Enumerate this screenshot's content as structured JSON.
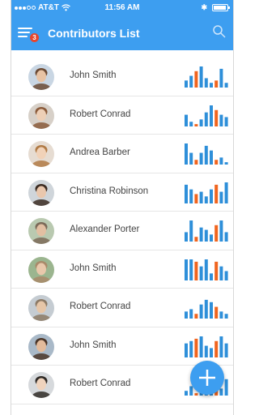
{
  "status_bar": {
    "carrier": "AT&T",
    "time": "11:56 AM",
    "bluetooth": "Ȣ"
  },
  "navbar": {
    "title": "Contributors List",
    "badge_count": "3",
    "menu_icon": "hamburger-menu-icon",
    "search_icon": "search-icon"
  },
  "colors": {
    "primary": "#3d9ef0",
    "badge": "#e8452c",
    "bar_blue": "#2e8fd9",
    "bar_orange": "#f0641e"
  },
  "contributors": [
    {
      "name": "John Smith",
      "bars": [
        3,
        5,
        7,
        9,
        4,
        2,
        3,
        8,
        2
      ]
    },
    {
      "name": "Robert Conrad",
      "bars": [
        5,
        2,
        1,
        3,
        6,
        9,
        7,
        5,
        4
      ]
    },
    {
      "name": "Andrea Barber",
      "bars": [
        9,
        5,
        2,
        5,
        8,
        6,
        2,
        3,
        1
      ]
    },
    {
      "name": "Christina Robinson",
      "bars": [
        8,
        6,
        4,
        5,
        3,
        6,
        8,
        5,
        9
      ]
    },
    {
      "name": "Alexander Porter",
      "bars": [
        4,
        9,
        2,
        6,
        5,
        3,
        7,
        9,
        4
      ]
    },
    {
      "name": "John Smith",
      "bars": [
        9,
        9,
        8,
        6,
        9,
        3,
        8,
        6,
        4
      ]
    },
    {
      "name": "Robert Conrad",
      "bars": [
        3,
        4,
        2,
        6,
        8,
        7,
        5,
        3,
        2
      ]
    },
    {
      "name": "John Smith",
      "bars": [
        6,
        7,
        8,
        9,
        5,
        4,
        7,
        9,
        6
      ]
    },
    {
      "name": "Robert Conrad",
      "bars": [
        2,
        4,
        1,
        5,
        6,
        8,
        5,
        3,
        7
      ]
    }
  ],
  "fab_icon": "plus-icon"
}
